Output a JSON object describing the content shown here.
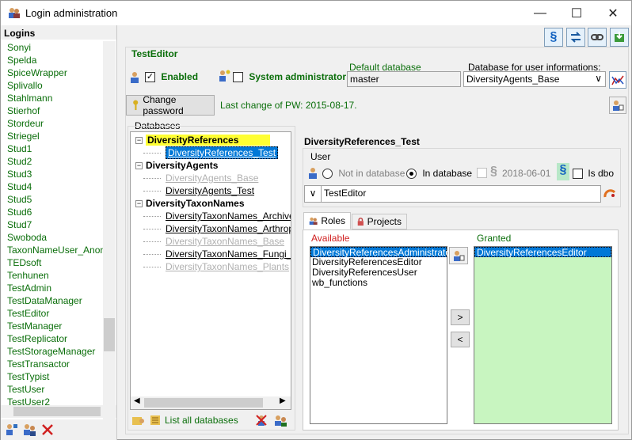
{
  "window": {
    "title": "Login administration",
    "minimize_glyph": "—",
    "maximize_glyph": "☐",
    "close_glyph": "✕"
  },
  "left_panel": {
    "header": "Logins",
    "logins": [
      "Sonyi",
      "Spelda",
      "SpiceWrapper",
      "Splivallo",
      "Stahlmann",
      "Stierhof",
      "Stordeur",
      "Striegel",
      "Stud1",
      "Stud2",
      "Stud3",
      "Stud4",
      "Stud5",
      "Stud6",
      "Stud7",
      "Swoboda",
      "TaxonNameUser_Anonym",
      "TEDsoft",
      "Tenhunen",
      "TestAdmin",
      "TestDataManager",
      "TestEditor",
      "TestManager",
      "TestReplicator",
      "TestStorageManager",
      "TestTransactor",
      "TestTypist",
      "TestUser",
      "TestUser2"
    ]
  },
  "toolbar": {
    "paragraph_glyph": "§"
  },
  "user": {
    "name": "TestEditor",
    "enabled_label": "Enabled",
    "enabled": true,
    "sysadmin_label": "System administrator",
    "sysadmin": false,
    "default_db_label": "Default database",
    "default_db_value": "master",
    "db_user_info_label": "Database for user informations:",
    "db_user_info_value": "DiversityAgents_Base",
    "change_pw_label": "Change password",
    "last_change": "Last change of PW: 2015-08-17."
  },
  "databases": {
    "label": "Databases",
    "tree": [
      {
        "text": "DiversityReferences",
        "kind": "group",
        "highlight": true,
        "expander": "−"
      },
      {
        "text": "DiversityReferences_Test",
        "kind": "selected"
      },
      {
        "text": "DiversityAgents",
        "kind": "group",
        "expander": "−"
      },
      {
        "text": "DiversityAgents_Base",
        "kind": "gray"
      },
      {
        "text": "DiversityAgents_Test",
        "kind": "normal"
      },
      {
        "text": "DiversityTaxonNames",
        "kind": "group",
        "expander": "−"
      },
      {
        "text": "DiversityTaxonNames_ArchiveTe",
        "kind": "normal"
      },
      {
        "text": "DiversityTaxonNames_Arthropoda",
        "kind": "normal"
      },
      {
        "text": "DiversityTaxonNames_Base",
        "kind": "gray"
      },
      {
        "text": "DiversityTaxonNames_Fungi_Test",
        "kind": "normal"
      },
      {
        "text": "DiversityTaxonNames_Plants",
        "kind": "gray"
      }
    ],
    "list_all_label": "List all databases"
  },
  "db_detail": {
    "title": "DiversityReferences_Test",
    "user_label": "User",
    "not_in_db_label": "Not in database",
    "in_db_label": "In database",
    "in_db_selected": true,
    "date": "2018-06-01",
    "paragraph_glyph": "§",
    "is_dbo_label": "Is dbo",
    "user_value": "TestEditor",
    "combo_arrow": "∨"
  },
  "tabs": [
    {
      "label": "Roles",
      "active": true
    },
    {
      "label": "Projects",
      "active": false
    }
  ],
  "roles": {
    "available_label": "Available",
    "granted_label": "Granted",
    "available": [
      "DiversityReferencesAdministrator",
      "DiversityReferencesEditor",
      "DiversityReferencesUser",
      "wb_functions"
    ],
    "granted": [
      "DiversityReferencesEditor"
    ],
    "add_glyph": ">",
    "remove_glyph": "<"
  },
  "colors": {
    "accent_green": "#0a6e0a",
    "highlight_yellow": "#ffff33",
    "selection_blue": "#0078d7",
    "granted_bg": "#c8f5c0"
  }
}
